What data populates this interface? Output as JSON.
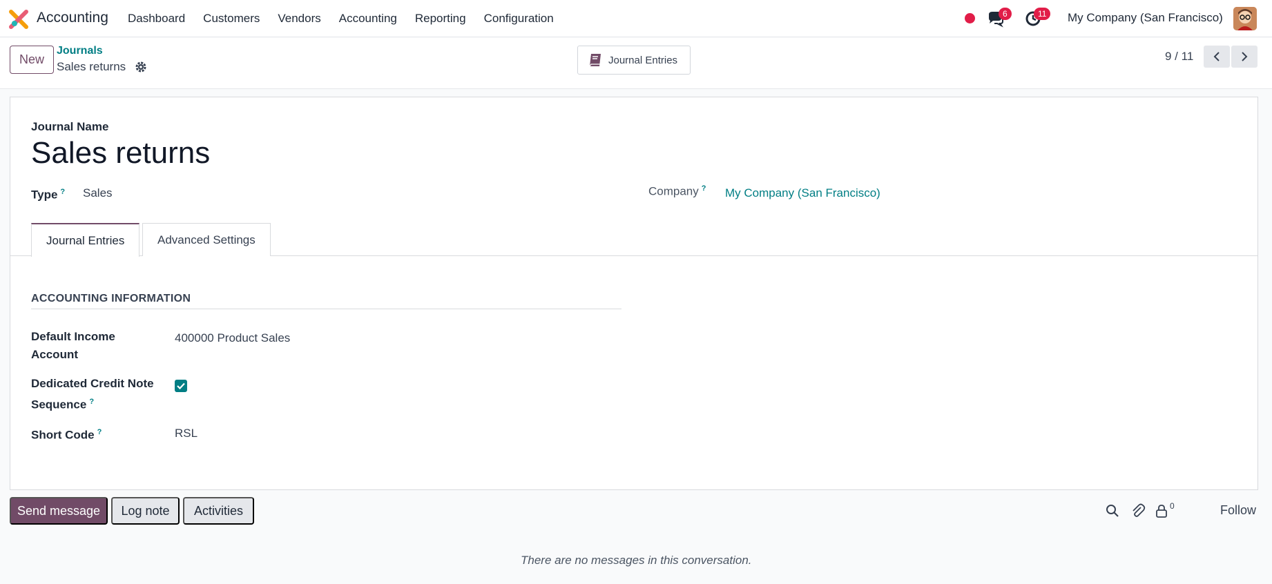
{
  "navbar": {
    "app_name": "Accounting",
    "menu": [
      "Dashboard",
      "Customers",
      "Vendors",
      "Accounting",
      "Reporting",
      "Configuration"
    ],
    "messages_badge": "6",
    "activities_badge": "11",
    "company": "My Company (San Francisco)",
    "recording_color": "#e11d48"
  },
  "control_panel": {
    "new_label": "New",
    "breadcrumb_parent": "Journals",
    "breadcrumb_current": "Sales returns",
    "smart_button_label": "Journal Entries",
    "pager": "9 / 11"
  },
  "form": {
    "journal_name_label": "Journal Name",
    "journal_name": "Sales returns",
    "type_label": "Type",
    "type_value": "Sales",
    "company_label": "Company",
    "company_value": "My Company (San Francisco)",
    "tabs": [
      "Journal Entries",
      "Advanced Settings"
    ],
    "active_tab": "Journal Entries",
    "section_title": "ACCOUNTING INFORMATION",
    "default_income_label_1": "Default Income",
    "default_income_label_2": "Account",
    "default_income_value": "400000 Product Sales",
    "credit_note_label_1": "Dedicated Credit Note",
    "credit_note_label_2": "Sequence",
    "credit_note_checked": true,
    "short_code_label": "Short Code",
    "short_code_value": "RSL",
    "help_mark": "?"
  },
  "chatter": {
    "send_label": "Send message",
    "log_label": "Log note",
    "activities_label": "Activities",
    "followers_count": "0",
    "follow_label": "Follow",
    "empty_message": "There are no messages in this conversation."
  },
  "colors": {
    "primary": "#714b67",
    "link": "#017e84",
    "badge": "#e11d48"
  }
}
